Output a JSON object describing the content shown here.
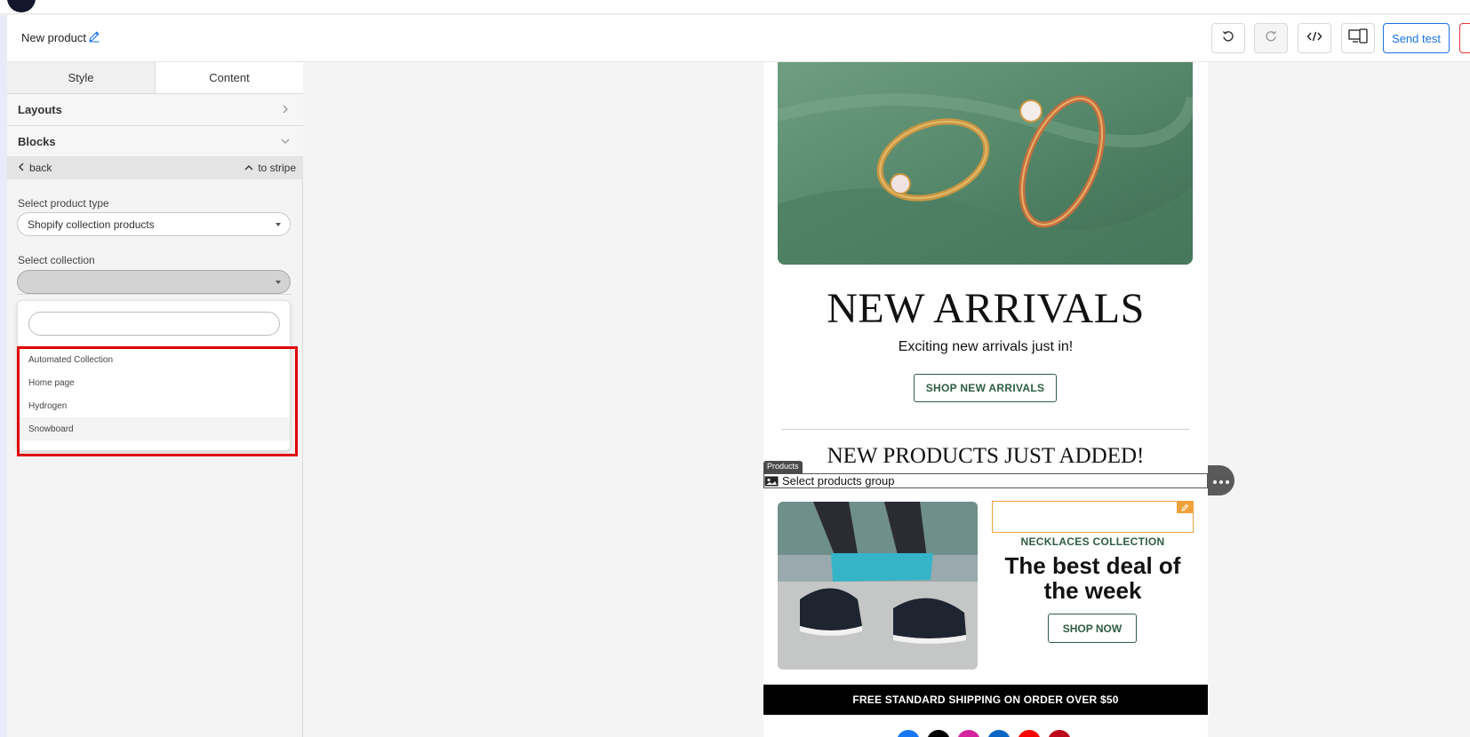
{
  "header": {
    "title": "New product",
    "send_test_label": "Send test",
    "icons": [
      "edit-icon",
      "undo-icon",
      "redo-icon",
      "code-icon",
      "devices-icon"
    ]
  },
  "sidebar": {
    "tabs": [
      {
        "label": "Style",
        "active": false
      },
      {
        "label": "Content",
        "active": true
      }
    ],
    "sections": [
      {
        "label": "Layouts",
        "icon": "chevron-right-icon"
      },
      {
        "label": "Blocks",
        "icon": "chevron-down-icon"
      }
    ],
    "back_label": "back",
    "to_stripe_label": "to stripe",
    "product_type": {
      "label": "Select product type",
      "value": "Shopify collection products"
    },
    "collection": {
      "label": "Select collection",
      "value": "",
      "search_value": "",
      "options": [
        "Automated Collection",
        "Home page",
        "Hydrogen",
        "Snowboard"
      ],
      "hovered_option": "Snowboard"
    }
  },
  "email": {
    "hero_title": "NEW ARRIVALS",
    "hero_subtitle": "Exciting new arrivals just in!",
    "hero_button": "SHOP NEW ARRIVALS",
    "section_title": "NEW PRODUCTS JUST ADDED!",
    "products_tag": "Products",
    "products_placeholder": "Select products group",
    "collection_label": "NECKLACES COLLECTION",
    "deal_title": "The best deal of the week",
    "deal_button": "SHOP NOW",
    "shipping_banner": "FREE STANDARD SHIPPING ON ORDER OVER $50",
    "social_icons": [
      {
        "name": "facebook-icon",
        "color": "#1877f2"
      },
      {
        "name": "x-icon",
        "color": "#000000"
      },
      {
        "name": "instagram-icon",
        "color": "#d6249f"
      },
      {
        "name": "linkedin-icon",
        "color": "#0a66c2"
      },
      {
        "name": "youtube-icon",
        "color": "#ff0000"
      },
      {
        "name": "pinterest-icon",
        "color": "#bd081c"
      }
    ]
  },
  "colors": {
    "accent_blue": "#1a73e8",
    "brand_green": "#2f5d43",
    "highlight_red": "#e00000",
    "edit_orange": "#f0a23a"
  }
}
